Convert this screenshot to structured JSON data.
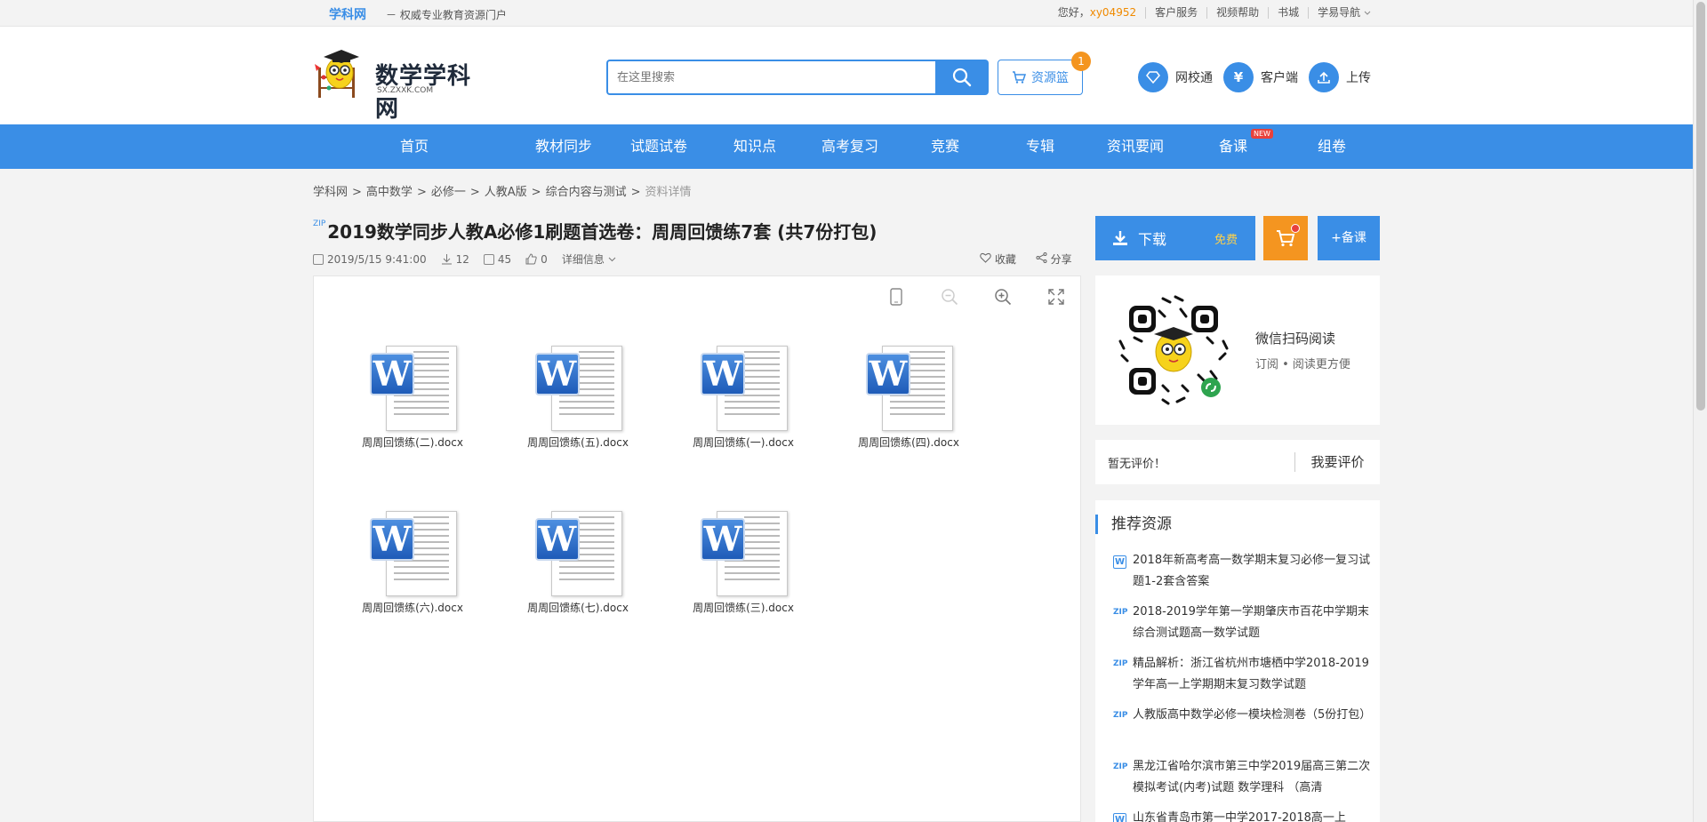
{
  "topbar": {
    "brand": "学科网",
    "slogan": "－ 权威专业教育资源门户",
    "greeting": "您好，",
    "username": "xy04952",
    "links": [
      "客户服务",
      "视频帮助",
      "书城",
      "学易导航"
    ]
  },
  "header": {
    "logo_name": "数学学科网",
    "logo_url": "SX.ZXXK.COM",
    "search_placeholder": "在这里搜索",
    "basket_label": "资源篮",
    "basket_count": "1",
    "icons": [
      {
        "label": "网校通",
        "icon": "diamond-icon"
      },
      {
        "label": "客户端",
        "icon": "yuan-icon"
      },
      {
        "label": "上传",
        "icon": "upload-icon"
      }
    ]
  },
  "nav": {
    "items": [
      "首页",
      "教材同步",
      "试题试卷",
      "知识点",
      "高考复习",
      "竞赛",
      "专辑",
      "资讯要闻",
      "备课",
      "组卷"
    ],
    "new_badge": "NEW"
  },
  "breadcrumb": [
    "学科网",
    "高中数学",
    "必修一",
    "人教A版",
    "综合内容与测试",
    "资料详情"
  ],
  "doc": {
    "type_tag": "ZIP",
    "title": "2019数学同步人教A必修1刷题首选卷：周周回馈练7套 (共7份打包)",
    "date": "2019/5/15 9:41:00",
    "downloads": "12",
    "views": "45",
    "likes": "0",
    "detail_label": "详细信息",
    "favorite_label": "收藏",
    "share_label": "分享"
  },
  "files": [
    {
      "name": "周周回馈练(二).docx"
    },
    {
      "name": "周周回馈练(五).docx"
    },
    {
      "name": "周周回馈练(一).docx"
    },
    {
      "name": "周周回馈练(四).docx"
    },
    {
      "name": "周周回馈练(六).docx"
    },
    {
      "name": "周周回馈练(七).docx"
    },
    {
      "name": "周周回馈练(三).docx"
    }
  ],
  "sidebar": {
    "download_label": "下载",
    "free_label": "免费",
    "prep_label": "+备课",
    "qr_title": "微信扫码阅读",
    "qr_subtitle": "订阅 • 阅读更方便",
    "no_review": "暂无评价！",
    "review_btn": "我要评价",
    "reco_title": "推荐资源",
    "reco_items": [
      {
        "tag": "W",
        "text": "2018年新高考高一数学期末复习必修一复习试题1-2套含答案"
      },
      {
        "tag": "ZIP",
        "text": "2018-2019学年第一学期肇庆市百花中学期末综合测试题高一数学试题"
      },
      {
        "tag": "ZIP",
        "text": "精品解析：浙江省杭州市塘栖中学2018-2019学年高一上学期期末复习数学试题"
      },
      {
        "tag": "ZIP",
        "text": "人教版高中数学必修一模块检测卷（5份打包）"
      },
      {
        "tag": "ZIP",
        "text": "黑龙江省哈尔滨市第三中学2019届高三第二次模拟考试(内考)试题 数学理科 （高清"
      },
      {
        "tag": "W",
        "text": "山东省青岛市第一中学2017-2018高一上"
      }
    ]
  },
  "word_icon_letter": "W"
}
